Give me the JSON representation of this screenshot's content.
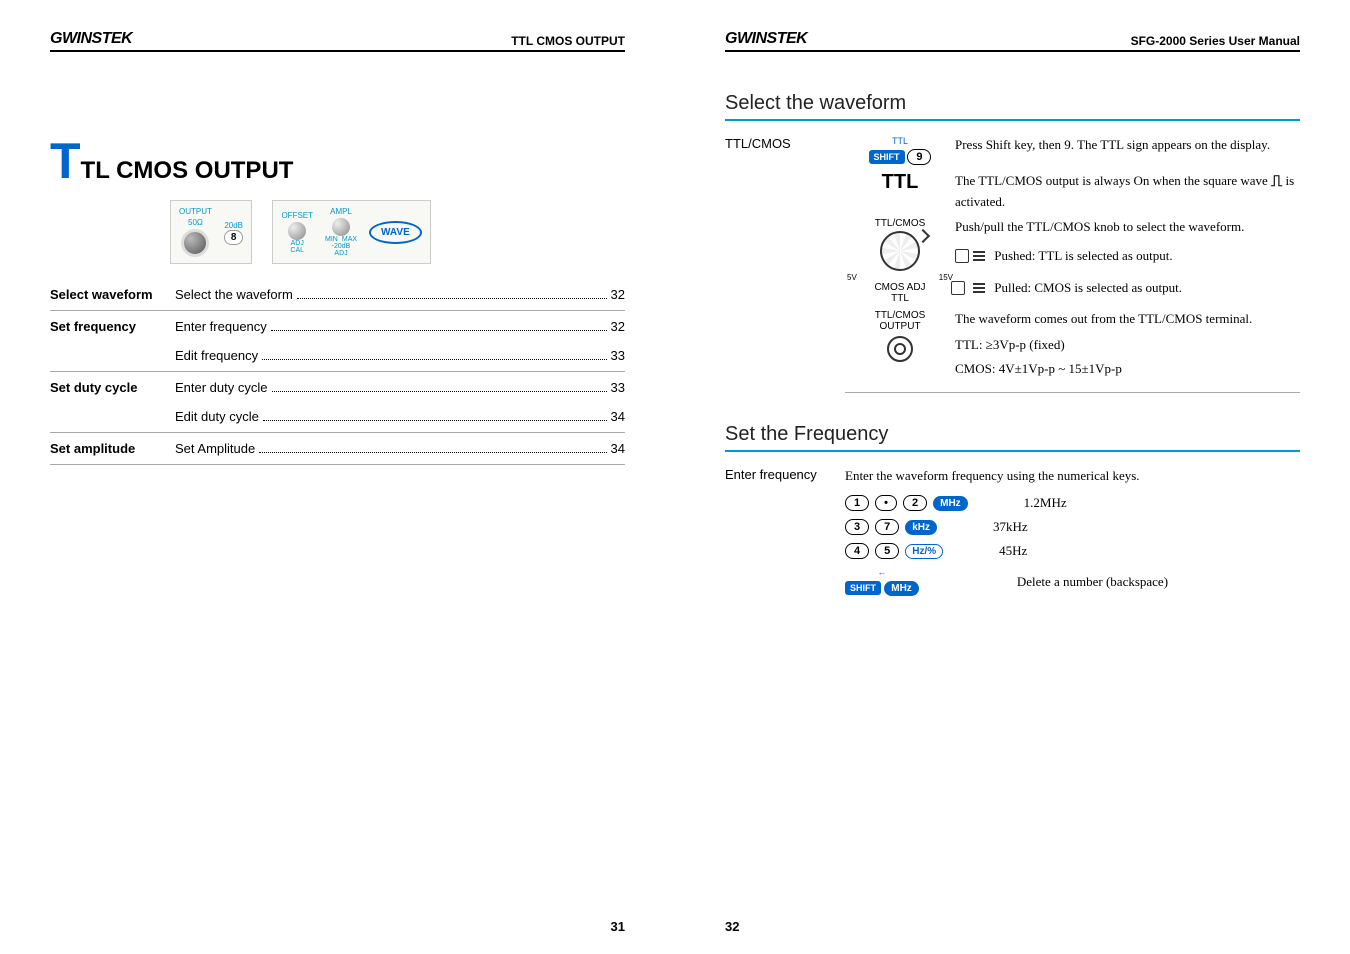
{
  "left": {
    "logo": "GWINSTEK",
    "header_title": "TTL CMOS OUTPUT",
    "title_first": "T",
    "title_rest": "TL CMOS OUTPUT",
    "panel": {
      "output_label": "OUTPUT",
      "output_sub": "50Ω",
      "atten_label": "20dB",
      "atten_key": "8",
      "offset_label": "OFFSET",
      "ampl_label": "AMPL",
      "min": "MIN",
      "max": "MAX",
      "adj1": "ADJ",
      "cal": "CAL",
      "neg20": "-20dB",
      "adj2": "ADJ",
      "wave": "WAVE"
    },
    "toc": [
      {
        "label": "Select waveform",
        "entries": [
          {
            "text": "Select the waveform",
            "page": "32"
          }
        ]
      },
      {
        "label": "Set frequency",
        "entries": [
          {
            "text": "Enter frequency",
            "page": "32"
          },
          {
            "text": "Edit frequency",
            "page": "33"
          }
        ]
      },
      {
        "label": "Set duty cycle",
        "entries": [
          {
            "text": "Enter duty cycle",
            "page": "33"
          },
          {
            "text": "Edit duty cycle",
            "page": "34"
          }
        ]
      },
      {
        "label": "Set amplitude",
        "entries": [
          {
            "text": "Set Amplitude",
            "page": "34"
          }
        ]
      }
    ],
    "page_num": "31"
  },
  "right": {
    "logo": "GWINSTEK",
    "header_title": "SFG-2000 Series User Manual",
    "section1": "Select the waveform",
    "ttlcmos_label": "TTL/CMOS",
    "shift": "SHIFT",
    "key9_top": "TTL",
    "key9": "9",
    "desc1": "Press Shift key, then 9. The TTL sign appears on the display.",
    "ttl_big": "TTL",
    "desc2a": "The TTL/CMOS output is always On when the square wave ",
    "desc2b": " is activated.",
    "knob_label_top": "TTL/CMOS",
    "knob_5v": "5V",
    "knob_15v": "15V",
    "knob_cmos": "CMOS ADJ",
    "knob_ttl": "TTL",
    "desc3": "Push/pull the TTL/CMOS knob to select the waveform.",
    "pushed": "Pushed: TTL is selected as output.",
    "pulled": "Pulled: CMOS is selected as output.",
    "terminal_top": "TTL/CMOS",
    "terminal_bot": "OUTPUT",
    "desc4": "The waveform comes out from the TTL/CMOS terminal.",
    "desc5": "TTL: ≥3Vp-p (fixed)",
    "desc6": "CMOS: 4V±1Vp-p ~ 15±1Vp-p",
    "section2": "Set the Frequency",
    "enter_freq_label": "Enter frequency",
    "enter_freq_desc": "Enter the waveform frequency using the numerical keys.",
    "rows": [
      {
        "keys": [
          "1",
          "•",
          "2"
        ],
        "unit": "MHz",
        "solid": true,
        "result": "1.2MHz"
      },
      {
        "keys": [
          "3",
          "7"
        ],
        "unit": "kHz",
        "solid": true,
        "result": "37kHz"
      },
      {
        "keys": [
          "4",
          "5"
        ],
        "unit": "Hz/%",
        "solid": false,
        "result": "45Hz"
      }
    ],
    "backspace_arrow": "←",
    "backspace_shift": "SHIFT",
    "backspace_unit": "MHz",
    "backspace_result": "Delete a number (backspace)",
    "page_num": "32"
  }
}
